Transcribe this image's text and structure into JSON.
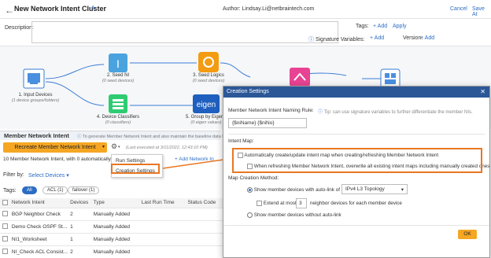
{
  "header": {
    "back_icon": "arrow-left",
    "title": "New Network Intent Cluster",
    "author": "Author:  Lindsay.Li@netbraintech.com",
    "cancel": "Cancel",
    "save": "Save At"
  },
  "desc": {
    "label": "Description:",
    "tags_label": "Tags:",
    "tags_add": "+ Add",
    "apply": "Apply",
    "sigvar_label": "Signature Variables:",
    "sigvar_add": "+ Add",
    "version_label": "Version:",
    "version_add": "+ Add"
  },
  "canvas": {
    "nodes": [
      {
        "label": "1. Input Devices",
        "sub": "(1 device groups/folders)"
      },
      {
        "label": "2. Seed NI",
        "sub": "(0 seed devices)"
      },
      {
        "label": "3. Seed Logics",
        "sub": "(0 seed devices)"
      },
      {
        "label": "4. Device Classifiers",
        "sub": "(0 classifiers)"
      },
      {
        "label": "5. Group by Eigen V",
        "sub": "(0 eigen values)"
      }
    ],
    "eigen_text": "eigen"
  },
  "list": {
    "title": "Member Network Intent",
    "info": "To generate Member Network Intent and also maintain the baseline data fo",
    "recreate": "Recreate Member Network Intent",
    "last_exec": "(Last executed at 3/11/2022, 12:43:10 PM)",
    "add_link": "+ Add Network In",
    "summary": "10 Member Network Intent, with 0 automatically gen",
    "filter_label": "Filter by:",
    "filter_value": "Select Devices",
    "tags_label": "Tags:",
    "chips": [
      "All",
      "ACL (1)",
      "failover (1)"
    ],
    "columns": [
      "Network Intent",
      "Devices",
      "Type",
      "Last Run Time",
      "Status Code"
    ],
    "rows": [
      [
        "BGP Neighbor Check",
        "2",
        "Manually Added",
        "",
        ""
      ],
      [
        "Demo Check OSPF St...",
        "1",
        "Manually Added",
        "",
        ""
      ],
      [
        "NI1_Worksheet",
        "1",
        "Manually Added",
        "",
        ""
      ],
      [
        "NI_Check ACL Consist...",
        "2",
        "Manually Added",
        "",
        ""
      ]
    ]
  },
  "menu": {
    "items": [
      "Run Settings",
      "Creation Settings"
    ]
  },
  "dialog": {
    "title": "Creation Settings",
    "naming_label": "Member Network Intent Naming Rule:",
    "naming_tip": "Tip: can use signature variables to further differentiate the member NIs.",
    "naming_value": "{$niName} {$niNo}",
    "intent_map_label": "Intent Map:",
    "auto_create": "Automatically create/update intent map when creating/refreshing Member Network Intent",
    "overwrite": "When refreshing Member Network Intent, overwrite all existing intent maps including manually created ones",
    "method_label": "Map Creation Method:",
    "show_with": "Show member devices with auto-link of",
    "topology": "IPv4 L3 Topology",
    "extend_at_most": "Extend at most",
    "extend_count": "3",
    "neighbor_text": "neighbor devices for each member device",
    "show_without": "Show member devices without auto-link",
    "ok": "OK",
    "close_icon": "close"
  },
  "colors": {
    "accent": "#2b6cc4",
    "orange": "#f5a623",
    "highlight": "#e87722",
    "dialog_header": "#2b5797"
  }
}
